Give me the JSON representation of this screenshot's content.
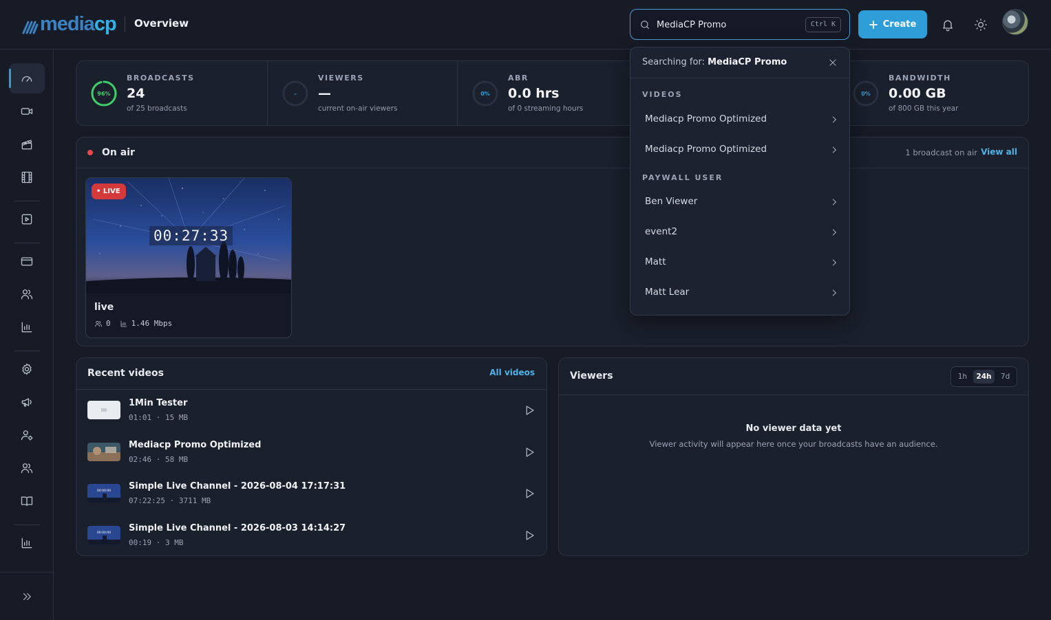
{
  "header": {
    "logo_text_dark": "media",
    "logo_text_light": "cp",
    "title": "Overview",
    "search": {
      "value": "MediaCP Promo",
      "shortcut": "Ctrl K"
    },
    "create_label": "Create"
  },
  "search_results": {
    "searching_prefix": "Searching for:",
    "query": "MediaCP Promo",
    "sections": [
      {
        "title": "VIDEOS",
        "items": [
          "Mediacp Promo Optimized",
          "Mediacp Promo Optimized"
        ]
      },
      {
        "title": "PAYWALL USER",
        "items": [
          "Ben Viewer",
          "event2",
          "Matt",
          "Matt Lear"
        ]
      }
    ]
  },
  "stats": [
    {
      "label": "BROADCASTS",
      "ring": "96%",
      "value": "24",
      "sub": "of 25 broadcasts",
      "fraction": 0.96,
      "color": "#3ccf6a"
    },
    {
      "label": "VIEWERS",
      "ring": "–",
      "value": "—",
      "sub": "current on-air viewers",
      "fraction": 0,
      "color": "#2f9ed8"
    },
    {
      "label": "ABR",
      "ring": "0%",
      "value": "0.0 hrs",
      "sub": "of 0 streaming hours",
      "fraction": 0,
      "color": "#2f9ed8"
    },
    {
      "label": "BANDWIDTH",
      "ring": "0%",
      "value": "0.00 GB",
      "sub": "of 800 GB this year",
      "fraction": 0,
      "color": "#2f9ed8"
    }
  ],
  "on_air": {
    "title": "On air",
    "count_text": "1 broadcast on air",
    "view_all": "View all",
    "broadcast": {
      "badge": "LIVE",
      "timer": "00:27:33",
      "name": "live",
      "viewers": "0",
      "bitrate": "1.46 Mbps"
    }
  },
  "recent_videos": {
    "title": "Recent videos",
    "link": "All videos",
    "items": [
      {
        "title": "1Min Tester",
        "duration": "01:01",
        "size": "15 MB",
        "thumb": "white"
      },
      {
        "title": "Mediacp Promo Optimized",
        "duration": "02:46",
        "size": "58 MB",
        "thumb": "promo"
      },
      {
        "title": "Simple Live Channel - 2026-08-04 17:17:31",
        "duration": "07:22:25",
        "size": "3711 MB",
        "thumb": "night"
      },
      {
        "title": "Simple Live Channel - 2026-08-03 14:14:27",
        "duration": "00:19",
        "size": "3 MB",
        "thumb": "night"
      }
    ]
  },
  "viewers_panel": {
    "title": "Viewers",
    "ranges": [
      "1h",
      "24h",
      "7d"
    ],
    "selected_range": "24h",
    "empty_title": "No viewer data yet",
    "empty_sub": "Viewer activity will appear here once your broadcasts have an audience."
  },
  "sidebar": {
    "icons": [
      "dashboard-icon",
      "camera-icon",
      "clapperboard-icon",
      "film-icon",
      "play-square-icon",
      "credit-card-icon",
      "users-icon",
      "bar-chart-icon",
      "settings-icon",
      "megaphone-icon",
      "user-cog-icon",
      "group-icon",
      "book-icon",
      "analytics-icon",
      "expand-icon"
    ]
  }
}
